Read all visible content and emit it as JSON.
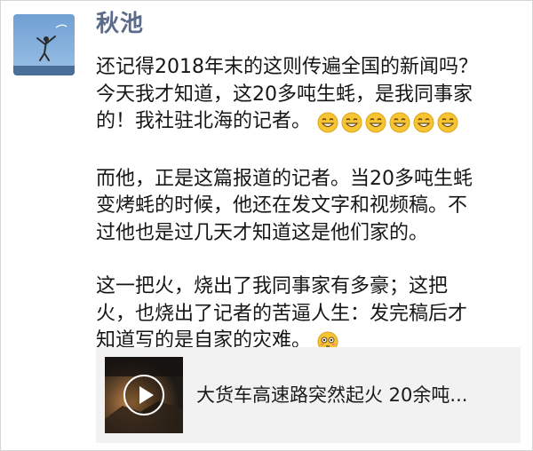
{
  "post": {
    "author": "秋池",
    "paragraphs": [
      {
        "lines": [
          "还记得2018年末的这则传遍全国的新闻吗？",
          "今天我才知道，这20多吨生蚝，是我同事家",
          "的！我社驻北海的记者。"
        ],
        "trailing_emojis": [
          "grin-emoji",
          "grin-emoji",
          "grin-emoji",
          "grin-emoji",
          "grin-emoji",
          "grin-emoji"
        ]
      },
      {
        "lines": [
          "而他，正是这篇报道的记者。当20多吨生蚝",
          "变烤蚝的时候，他还在发文字和视频稿。不",
          "过他也是过几天才知道这是他们家的。"
        ]
      },
      {
        "lines": [
          "这一把火，烧出了我同事家有多豪；这把",
          "火，也烧出了记者的苦逼人生：发完稿后才",
          "知道写的是自家的灾难。"
        ],
        "trailing_emojis": [
          "flushed-emoji"
        ]
      }
    ]
  },
  "link_card": {
    "title": "大货车高速路突然起火 20余吨...",
    "thumbnail": "video-thumbnail",
    "play_icon": "play-icon"
  },
  "colors": {
    "author": "#5b6b8c",
    "card_bg": "#f2f2f2",
    "emoji_yellow": "#f7c531"
  }
}
